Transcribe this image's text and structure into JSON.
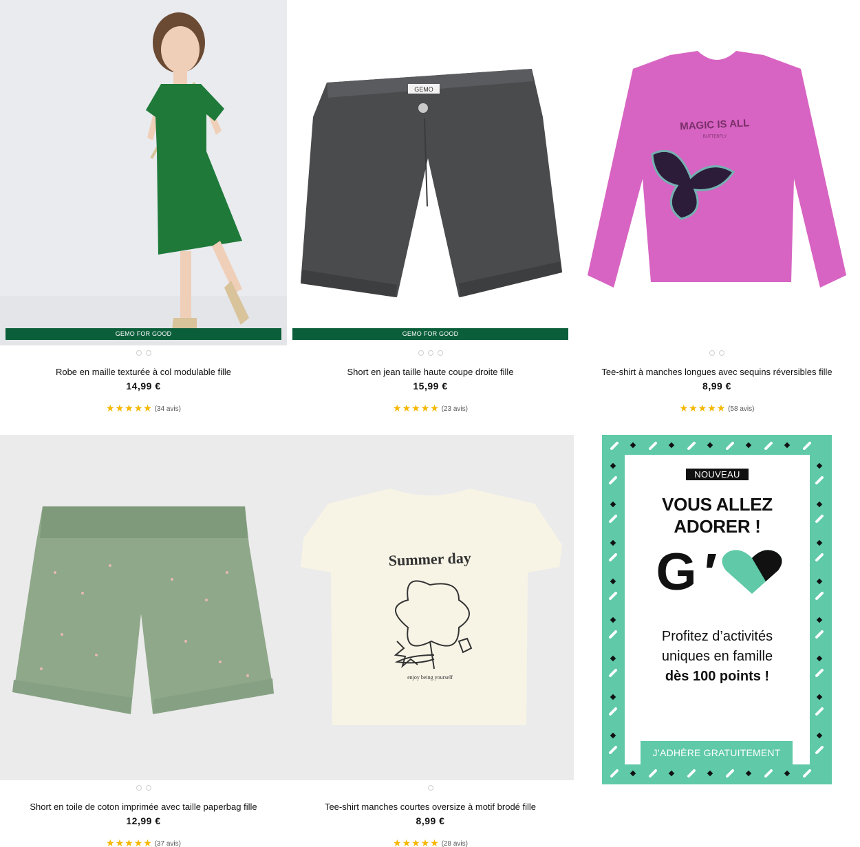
{
  "products": [
    {
      "title": "Robe en maille texturée à col modulable fille",
      "price": "14,99 €",
      "stars": "★★★★★",
      "reviews": "(34 avis)",
      "badge": "GEMO FOR GOOD"
    },
    {
      "title": "Short en jean taille haute coupe droite fille",
      "price": "15,99 €",
      "stars": "★★★★★",
      "reviews": "(23 avis)",
      "badge": "GEMO FOR GOOD"
    },
    {
      "title": "Tee-shirt à manches longues avec sequins réversibles fille",
      "price": "8,99 €",
      "stars": "★★★★★",
      "reviews": "(58 avis)"
    },
    {
      "title": "Short en toile de coton imprimée avec taille paperbag fille",
      "price": "12,99 €",
      "stars": "★★★★★",
      "reviews": "(37 avis)"
    },
    {
      "title": "Tee-shirt manches courtes oversize à motif brodé fille",
      "price": "8,99 €",
      "stars": "★★★★★",
      "reviews": "(28 avis)"
    }
  ],
  "garments": {
    "jeans_label": "GEMO",
    "pink_tee_text": "MAGIC IS ALL",
    "pink_tee_sub": "BUTTERFLY",
    "white_tee_text": "Summer day",
    "white_tee_sub": "enjoy being yourself"
  },
  "promo": {
    "tag": "NOUVEAU",
    "headline_1": "VOUS ALLEZ",
    "headline_2": "ADORER !",
    "logo_letter": "G",
    "body_1": "Profitez d’activités",
    "body_2": "uniques en famille",
    "body_3": "dès 100 points !",
    "cta": "J’ADHÈRE GRATUITEMENT",
    "colors": {
      "accent": "#5fc9a8",
      "dark": "#111111"
    }
  },
  "colors": {
    "badge_green": "#0b5e3a",
    "star": "#f5b700"
  }
}
